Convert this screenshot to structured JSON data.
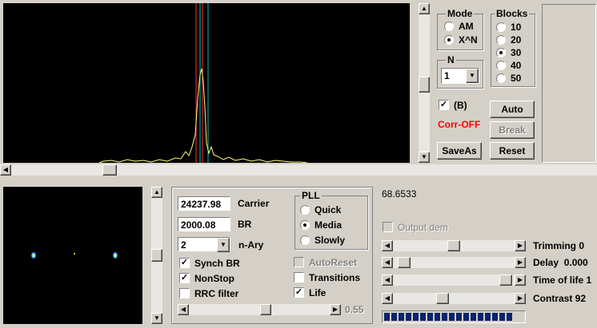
{
  "spectrum": {
    "background": "#000000",
    "trace_color": "#ffff80",
    "marker_colors": [
      "#ff3030",
      "#00c0c0"
    ]
  },
  "mode": {
    "title": "Mode",
    "options": [
      "AM",
      "X^N"
    ],
    "selected": "X^N"
  },
  "blocks": {
    "title": "Blocks",
    "options": [
      "10",
      "20",
      "30",
      "40",
      "50"
    ],
    "selected": "30"
  },
  "n_group": {
    "title": "N",
    "value": "1"
  },
  "b_check": {
    "label": "(B)",
    "checked": true
  },
  "corr_status": {
    "text": "Corr-OFF",
    "color": "#ff0000"
  },
  "buttons": {
    "auto": "Auto",
    "break": "Break",
    "reset": "Reset",
    "saveas": "SaveAs"
  },
  "readout": "68.6533",
  "params": {
    "carrier_value": "24237.98",
    "carrier_label": "Carrier",
    "br_value": "2000.08",
    "br_label": "BR",
    "nary_value": "2",
    "nary_label": "n-Ary"
  },
  "pll": {
    "title": "PLL",
    "options": [
      "Quick",
      "Media",
      "Slowly"
    ],
    "selected": "Media"
  },
  "checks": {
    "synch_br": {
      "label": "Synch BR",
      "checked": true
    },
    "nonstop": {
      "label": "NonStop",
      "checked": true
    },
    "rrc_filter": {
      "label": "RRC filter",
      "checked": false
    },
    "autoreset": {
      "label": "AutoReset",
      "checked": false,
      "disabled": true
    },
    "transitions": {
      "label": "Transitions",
      "checked": false
    },
    "life": {
      "label": "Life",
      "checked": true
    },
    "output_dem": {
      "label": "Output dem",
      "checked": false,
      "disabled": true
    }
  },
  "rolloff": {
    "value": "0.55",
    "level": 0.55
  },
  "sliders": {
    "trimming": {
      "label": "Trimming 0",
      "level": 0.5
    },
    "delay": {
      "label": "Delay  0.000",
      "level": 0.05
    },
    "time_of_life": {
      "label": "Time of life 1",
      "level": 0.97
    },
    "contrast": {
      "label": "Contrast 92",
      "level": 0.4
    }
  },
  "progress": {
    "segments_filled": 18,
    "color": "#0a246a"
  }
}
